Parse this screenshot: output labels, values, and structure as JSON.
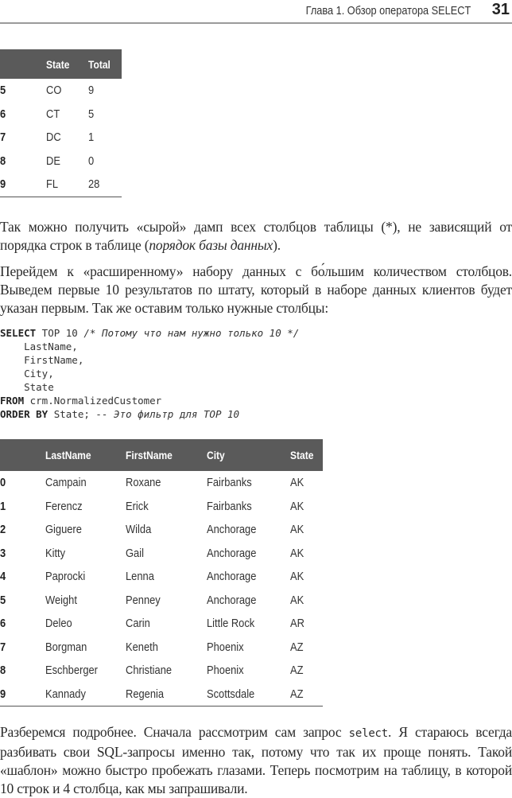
{
  "header": {
    "chapter_title": "Глава 1. Обзор оператора SELECT",
    "page_number": "31"
  },
  "table1": {
    "columns": [
      "",
      "State",
      "Total"
    ],
    "rows": [
      [
        "5",
        "CO",
        "9"
      ],
      [
        "6",
        "CT",
        "5"
      ],
      [
        "7",
        "DC",
        "1"
      ],
      [
        "8",
        "DE",
        "0"
      ],
      [
        "9",
        "FL",
        "28"
      ]
    ]
  },
  "paragraph1": {
    "text_before": "Так можно получить «сырой» дамп всех столбцов таблицы (*), не зависящий от порядка строк в таблице (",
    "italic": "порядок базы данных",
    "text_after": ")."
  },
  "paragraph2": {
    "text": "Перейдем к «расширенному» набору данных с бо́льшим количеством столбцов. Выведем первые 10 результатов по штату, который в наборе данных клиентов будет указан первым. Так же оставим только нужные столбцы:"
  },
  "code": {
    "line1_kw": "SELECT",
    "line1_text": " TOP 10 ",
    "line1_comment": "/* Потому что нам нужно только 10 */",
    "line2": "    LastName,",
    "line3": "    FirstName,",
    "line4": "    City,",
    "line5": "    State",
    "line6_kw": "FROM",
    "line6_text": " crm.NormalizedCustomer",
    "line7_kw": "ORDER BY",
    "line7_text": " State; ",
    "line7_comment": "-- Это фильтр для TOP 10"
  },
  "table2": {
    "columns": [
      "",
      "LastName",
      "FirstName",
      "City",
      "State"
    ],
    "rows": [
      [
        "0",
        "Campain",
        "Roxane",
        "Fairbanks",
        "AK"
      ],
      [
        "1",
        "Ferencz",
        "Erick",
        "Fairbanks",
        "AK"
      ],
      [
        "2",
        "Giguere",
        "Wilda",
        "Anchorage",
        "AK"
      ],
      [
        "3",
        "Kitty",
        "Gail",
        "Anchorage",
        "AK"
      ],
      [
        "4",
        "Paprocki",
        "Lenna",
        "Anchorage",
        "AK"
      ],
      [
        "5",
        "Weight",
        "Penney",
        "Anchorage",
        "AK"
      ],
      [
        "6",
        "Deleo",
        "Carin",
        "Little Rock",
        "AR"
      ],
      [
        "7",
        "Borgman",
        "Keneth",
        "Phoenix",
        "AZ"
      ],
      [
        "8",
        "Eschberger",
        "Christiane",
        "Phoenix",
        "AZ"
      ],
      [
        "9",
        "Kannady",
        "Regenia",
        "Scottsdale",
        "AZ"
      ]
    ]
  },
  "paragraph3": {
    "text_before": "Разберемся подробнее. Сначала рассмотрим сам запрос ",
    "code": "select",
    "text_after": ". Я стараюсь всегда разбивать свои SQL-запросы именно так, потому что так их проще понять. Такой «шаблон» можно быстро пробежать глазами. Теперь посмотрим на таблицу, в которой 10 строк и 4 столбца, как мы запрашивали."
  }
}
